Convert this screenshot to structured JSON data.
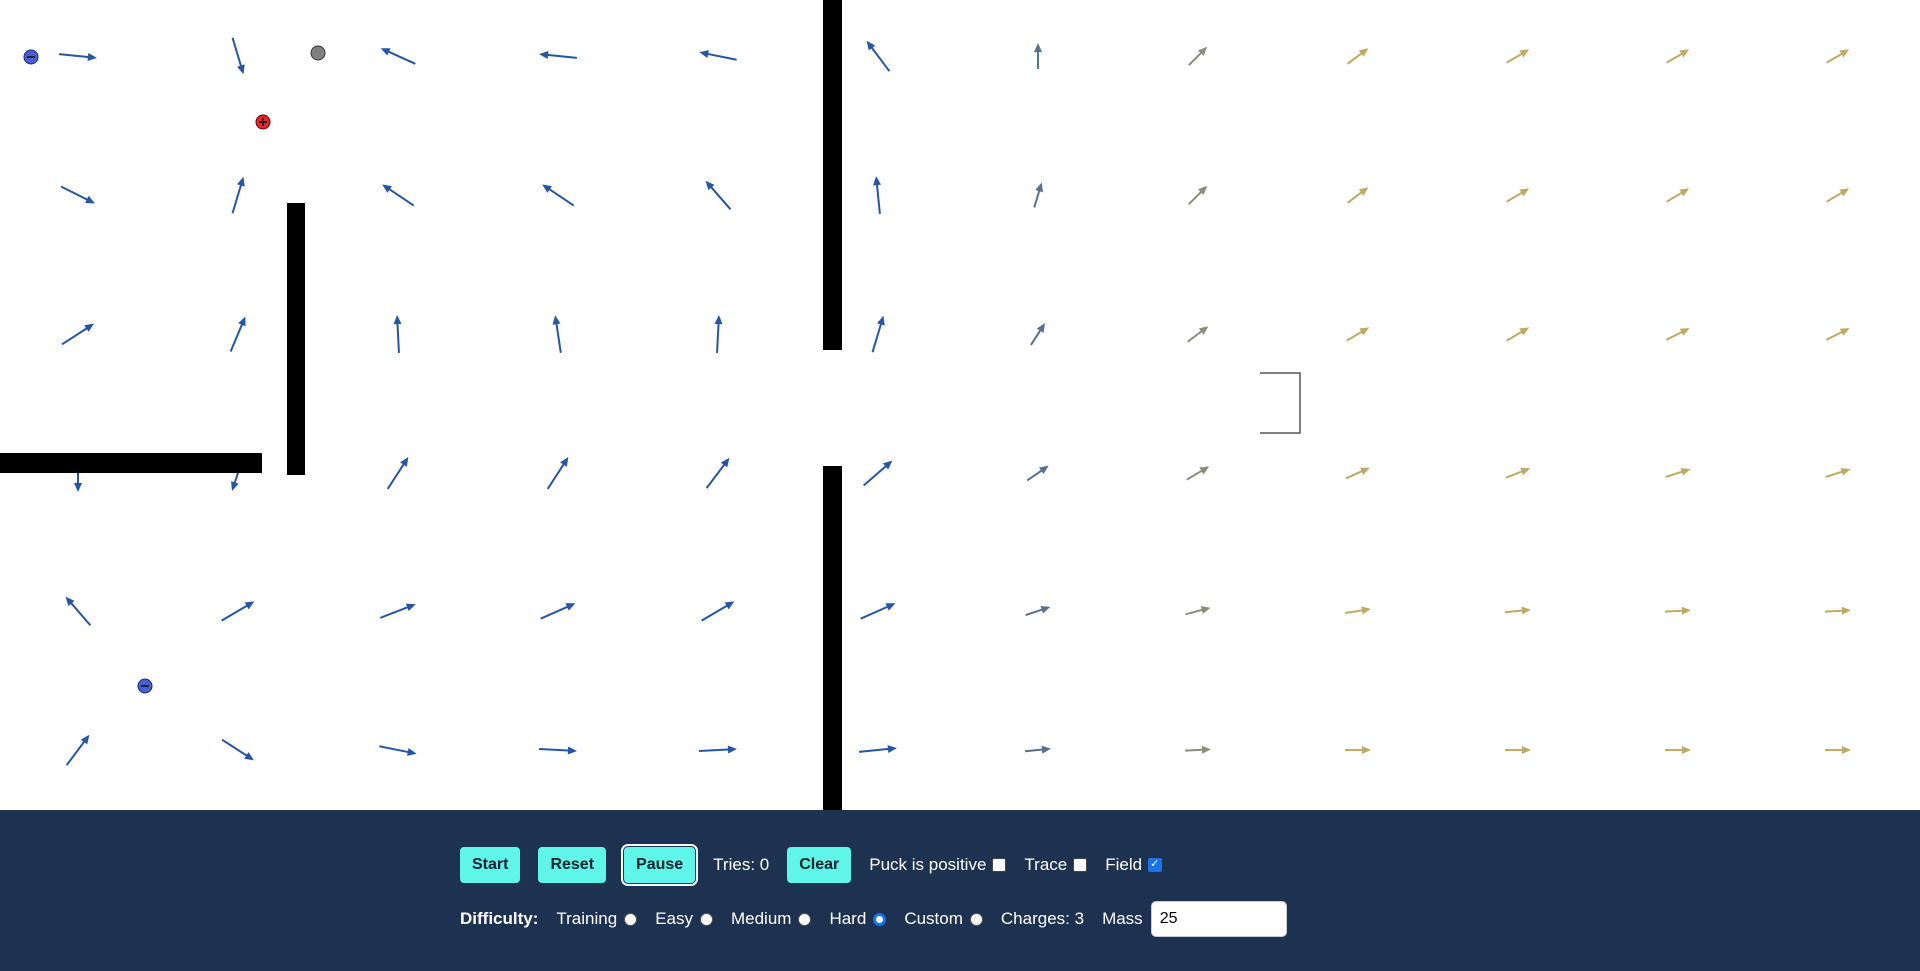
{
  "colors": {
    "toolbar_bg": "#1d3150",
    "button_bg": "#5ff5e8",
    "negative_charge": "#4a5fd6",
    "positive_charge": "#e0282e",
    "puck": "#808080",
    "wall": "#000000"
  },
  "controls": {
    "start_label": "Start",
    "reset_label": "Reset",
    "pause_label": "Pause",
    "tries_label": "Tries: 0",
    "clear_label": "Clear",
    "puck_positive_label": "Puck is positive",
    "puck_positive_checked": false,
    "trace_label": "Trace",
    "trace_checked": false,
    "field_label": "Field",
    "field_checked": true
  },
  "difficulty": {
    "label": "Difficulty:",
    "options": [
      "Training",
      "Easy",
      "Medium",
      "Hard",
      "Custom"
    ],
    "selected": "Hard",
    "charges_label": "Charges: 3",
    "mass_label": "Mass",
    "mass_value": "25"
  },
  "field_icons": {
    "arrow": "field-arrow-icon",
    "negative": "negative-charge-icon",
    "positive": "positive-charge-icon",
    "puck": "puck-icon",
    "goal": "goal-bracket"
  }
}
